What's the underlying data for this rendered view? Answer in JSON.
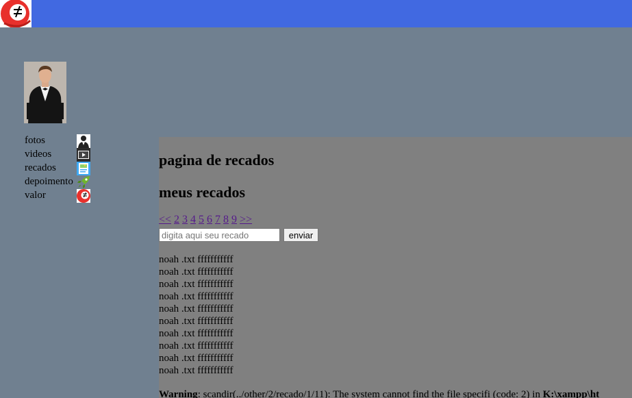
{
  "header": {
    "logo_icon": "not-equal-logo-icon",
    "bar_color": "#4169e1"
  },
  "profile": {
    "photo_icon": "profile-photo-man-in-tuxedo"
  },
  "sidebar": {
    "items": [
      {
        "label": "fotos",
        "icon": "person-icon"
      },
      {
        "label": "videos",
        "icon": "video-icon"
      },
      {
        "label": "recados",
        "icon": "image-note-icon"
      },
      {
        "label": "depoimento",
        "icon": "rocket-icon"
      },
      {
        "label": "valor",
        "icon": "not-equal-logo-icon"
      }
    ]
  },
  "main": {
    "page_title": "pagina de recados",
    "section_title": "meus recados",
    "pagination": {
      "prev": "<<",
      "pages": [
        "2",
        "3",
        "4",
        "5",
        "6",
        "7",
        "8",
        "9"
      ],
      "next": ">>"
    },
    "form": {
      "placeholder": "digita aqui seu recado",
      "value": "",
      "submit_label": "enviar"
    },
    "messages": [
      "noah .txt fffffffffff",
      "noah .txt fffffffffff",
      "noah .txt fffffffffff",
      "noah .txt fffffffffff",
      "noah .txt fffffffffff",
      "noah .txt fffffffffff",
      "noah .txt fffffffffff",
      "noah .txt fffffffffff",
      "noah .txt fffffffffff",
      "noah .txt fffffffffff"
    ],
    "warning": {
      "label": "Warning",
      "text": ": scandir(../other/2/recado/1/11): The system cannot find the file specifi (code: 2) in ",
      "path": "K:\\xampp\\ht"
    }
  }
}
